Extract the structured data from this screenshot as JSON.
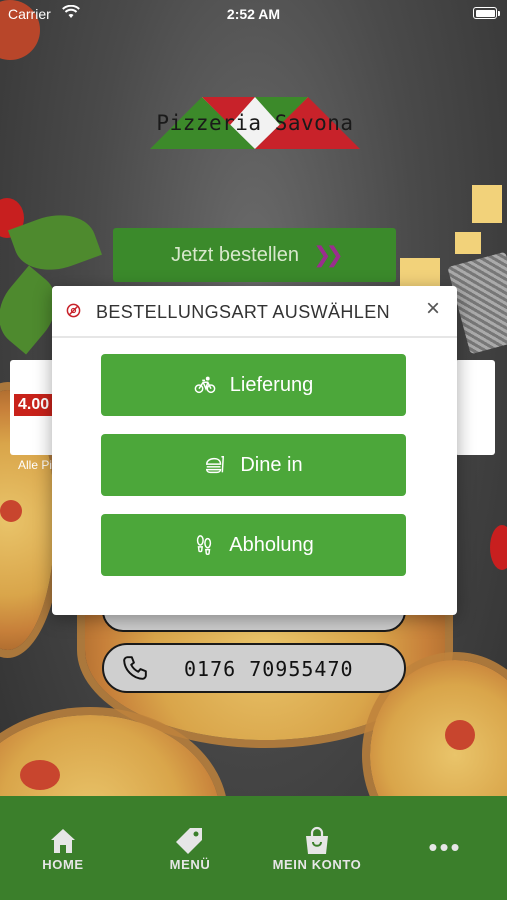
{
  "status_bar": {
    "carrier": "Carrier",
    "time": "2:52 AM"
  },
  "logo": {
    "text": "Pizzeria Savona"
  },
  "cta": {
    "label": "Jetzt bestellen"
  },
  "promo": {
    "price": "4.00",
    "caption": "Alle Pi"
  },
  "phone": {
    "number": "0176 70955470"
  },
  "modal": {
    "title": "BESTELLUNGSART AUSWÄHLEN",
    "close_label": "×",
    "options": [
      {
        "label": "Lieferung",
        "icon": "bicycle-icon"
      },
      {
        "label": "Dine in",
        "icon": "food-icon"
      },
      {
        "label": "Abholung",
        "icon": "footsteps-icon"
      }
    ]
  },
  "tabbar": {
    "items": [
      {
        "label": "HOME",
        "icon": "home-icon"
      },
      {
        "label": "MENÜ",
        "icon": "tag-icon"
      },
      {
        "label": "MEIN KONTO",
        "icon": "bag-icon"
      },
      {
        "label": "",
        "icon": "more-icon"
      }
    ]
  },
  "colors": {
    "brand_green": "#4ca73a",
    "tab_green": "#3b7f2b",
    "accent_purple": "#9b2d8e",
    "price_red": "#c8221a"
  }
}
